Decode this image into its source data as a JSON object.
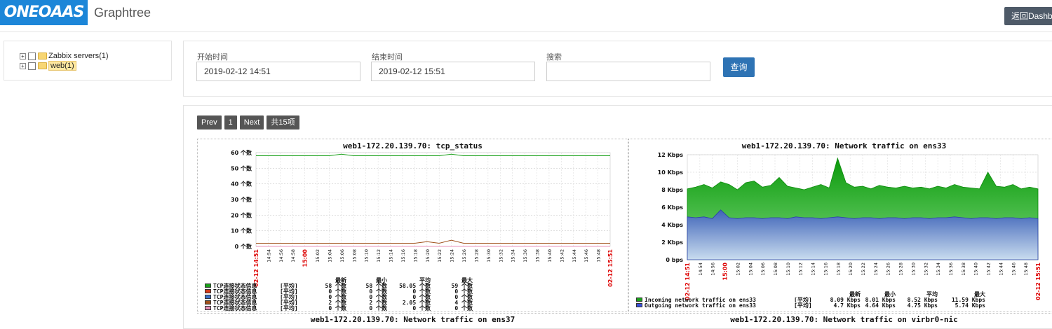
{
  "app": {
    "logo": "ONEOAAS",
    "title": "Graphtree",
    "dashboard_button": "返回Dashboard"
  },
  "tree": {
    "items": [
      {
        "expander": "+",
        "label": "Zabbix servers(1)",
        "selected": false
      },
      {
        "expander": "+",
        "label": "web(1)",
        "selected": true
      }
    ]
  },
  "search": {
    "start_label": "开始时间",
    "start_value": "2019-02-12 14:51",
    "end_label": "结束时间",
    "end_value": "2019-02-12 15:51",
    "search_label": "搜索",
    "search_value": "",
    "query_button": "查询"
  },
  "pager": {
    "prev": "Prev",
    "page": "1",
    "next": "Next",
    "total": "共15项"
  },
  "graphs": [
    {
      "title": "web1-172.20.139.70: tcp_status",
      "yticks": [
        "60 个数",
        "50 个数",
        "40 个数",
        "30 个数",
        "20 个数",
        "10 个数",
        "0 个数"
      ],
      "xticks": [
        "02-12 14:51",
        "14:54",
        "14:56",
        "14:58",
        "15:00",
        "15:02",
        "15:04",
        "15:06",
        "15:08",
        "15:10",
        "15:12",
        "15:14",
        "15:16",
        "15:18",
        "15:20",
        "15:22",
        "15:24",
        "15:26",
        "15:28",
        "15:30",
        "15:32",
        "15:34",
        "15:36",
        "15:38",
        "15:40",
        "15:42",
        "15:44",
        "15:46",
        "15:48",
        "02-12 15:51"
      ],
      "legend_headers": [
        "最新",
        "最小",
        "平均",
        "最大"
      ],
      "legend": [
        {
          "name": "TCP连接状态信息",
          "color": "#1aa01a",
          "agg": "[平均]",
          "last": "58 个数",
          "min": "58 个数",
          "avg": "58.05 个数",
          "max": "59 个数"
        },
        {
          "name": "TCP连接状态信息",
          "color": "#d83a1a",
          "agg": "[平均]",
          "last": "0 个数",
          "min": "0 个数",
          "avg": "0 个数",
          "max": "0 个数"
        },
        {
          "name": "TCP连接状态信息",
          "color": "#3a6fc8",
          "agg": "[平均]",
          "last": "0 个数",
          "min": "0 个数",
          "avg": "0 个数",
          "max": "0 个数"
        },
        {
          "name": "TCP连接状态信息",
          "color": "#a0501a",
          "agg": "[平均]",
          "last": "2 个数",
          "min": "2 个数",
          "avg": "2.05 个数",
          "max": "4 个数"
        },
        {
          "name": "TCP连接状态信息",
          "color": "#e890b8",
          "agg": "[平均]",
          "last": "0 个数",
          "min": "0 个数",
          "avg": "0 个数",
          "max": "0 个数"
        }
      ]
    },
    {
      "title": "web1-172.20.139.70: Network traffic on ens33",
      "yticks": [
        "12 Kbps",
        "10 Kbps",
        "8 Kbps",
        "6 Kbps",
        "4 Kbps",
        "2 Kbps",
        "0 bps"
      ],
      "xticks": [
        "02-12 14:51",
        "14:54",
        "14:56",
        "15:00",
        "15:02",
        "15:04",
        "15:06",
        "15:08",
        "15:10",
        "15:12",
        "15:14",
        "15:16",
        "15:18",
        "15:20",
        "15:22",
        "15:24",
        "15:26",
        "15:28",
        "15:30",
        "15:32",
        "15:34",
        "15:36",
        "15:38",
        "15:40",
        "15:42",
        "15:44",
        "15:46",
        "15:48",
        "02-12 15:51"
      ],
      "legend_headers": [
        "最新",
        "最小",
        "平均",
        "最大"
      ],
      "legend": [
        {
          "name": "Incoming network traffic on ens33",
          "color": "#1aa01a",
          "agg": "[平均]",
          "last": "8.09 Kbps",
          "min": "8.01 Kbps",
          "avg": "8.52 Kbps",
          "max": "11.59 Kbps"
        },
        {
          "name": "Outgoing network traffic on ens33",
          "color": "#3a4fd8",
          "agg": "[平均]",
          "last": "4.7 Kbps",
          "min": "4.64 Kbps",
          "avg": "4.75 Kbps",
          "max": "5.74 Kbps"
        }
      ]
    },
    {
      "title": "web1-172.20.139.70: Network traffic on ens37"
    },
    {
      "title": "web1-172.20.139.70: Network traffic on virbr0-nic"
    }
  ],
  "chart_data": [
    {
      "type": "line",
      "title": "web1-172.20.139.70: tcp_status",
      "ylim": [
        0,
        60
      ],
      "series": [
        {
          "name": "TCP连接状态信息",
          "values": [
            58,
            58,
            58,
            58,
            58,
            58,
            58,
            59,
            58,
            58,
            58,
            58,
            58,
            58,
            58,
            58,
            59,
            58,
            58,
            58,
            58,
            58,
            58,
            58,
            58,
            58,
            58,
            58,
            58,
            58
          ]
        },
        {
          "name": "TCP连接状态信息",
          "values": [
            0,
            0,
            0,
            0,
            0,
            0,
            0,
            0,
            0,
            0,
            0,
            0,
            0,
            0,
            0,
            0,
            0,
            0,
            0,
            0,
            0,
            0,
            0,
            0,
            0,
            0,
            0,
            0,
            0,
            0
          ]
        },
        {
          "name": "TCP连接状态信息",
          "values": [
            0,
            0,
            0,
            0,
            0,
            0,
            0,
            0,
            0,
            0,
            0,
            0,
            0,
            0,
            0,
            0,
            0,
            0,
            0,
            0,
            0,
            0,
            0,
            0,
            0,
            0,
            0,
            0,
            0,
            0
          ]
        },
        {
          "name": "TCP连接状态信息",
          "values": [
            2,
            2,
            2,
            2,
            2,
            2,
            2,
            2,
            2,
            2,
            2,
            2,
            2,
            2,
            3,
            2,
            4,
            2,
            2,
            2,
            2,
            2,
            2,
            2,
            2,
            2,
            2,
            2,
            2,
            2
          ]
        },
        {
          "name": "TCP连接状态信息",
          "values": [
            0,
            0,
            0,
            0,
            0,
            0,
            0,
            0,
            0,
            0,
            0,
            0,
            0,
            0,
            0,
            0,
            0,
            0,
            0,
            0,
            0,
            0,
            0,
            0,
            0,
            0,
            0,
            0,
            0,
            0
          ]
        }
      ]
    },
    {
      "type": "area",
      "title": "web1-172.20.139.70: Network traffic on ens33",
      "ylim": [
        0,
        12
      ],
      "series": [
        {
          "name": "Incoming network traffic on ens33",
          "values": [
            8.1,
            8.3,
            8.6,
            8.2,
            8.9,
            8.6,
            8.0,
            8.8,
            9.0,
            8.3,
            8.5,
            9.4,
            8.4,
            8.2,
            8.0,
            8.3,
            8.6,
            8.2,
            11.6,
            8.8,
            8.3,
            8.4,
            8.1,
            8.5,
            8.3,
            8.2,
            8.4,
            8.2,
            8.3,
            8.1,
            8.4,
            8.2,
            8.6,
            8.3,
            8.2,
            8.1,
            10.0,
            8.4,
            8.3,
            8.6,
            8.1,
            8.3,
            8.1
          ]
        },
        {
          "name": "Outgoing network traffic on ens33",
          "values": [
            4.9,
            4.8,
            4.9,
            4.7,
            5.7,
            4.8,
            4.7,
            4.8,
            4.8,
            4.7,
            4.8,
            4.8,
            4.7,
            4.9,
            4.8,
            4.8,
            4.7,
            4.8,
            4.9,
            4.8,
            4.7,
            4.8,
            4.8,
            4.7,
            4.8,
            4.8,
            4.7,
            4.8,
            4.8,
            4.7,
            4.8,
            4.8,
            4.9,
            4.8,
            4.7,
            4.8,
            4.8,
            4.7,
            4.8,
            4.8,
            4.7,
            4.8,
            4.7
          ]
        }
      ]
    }
  ]
}
